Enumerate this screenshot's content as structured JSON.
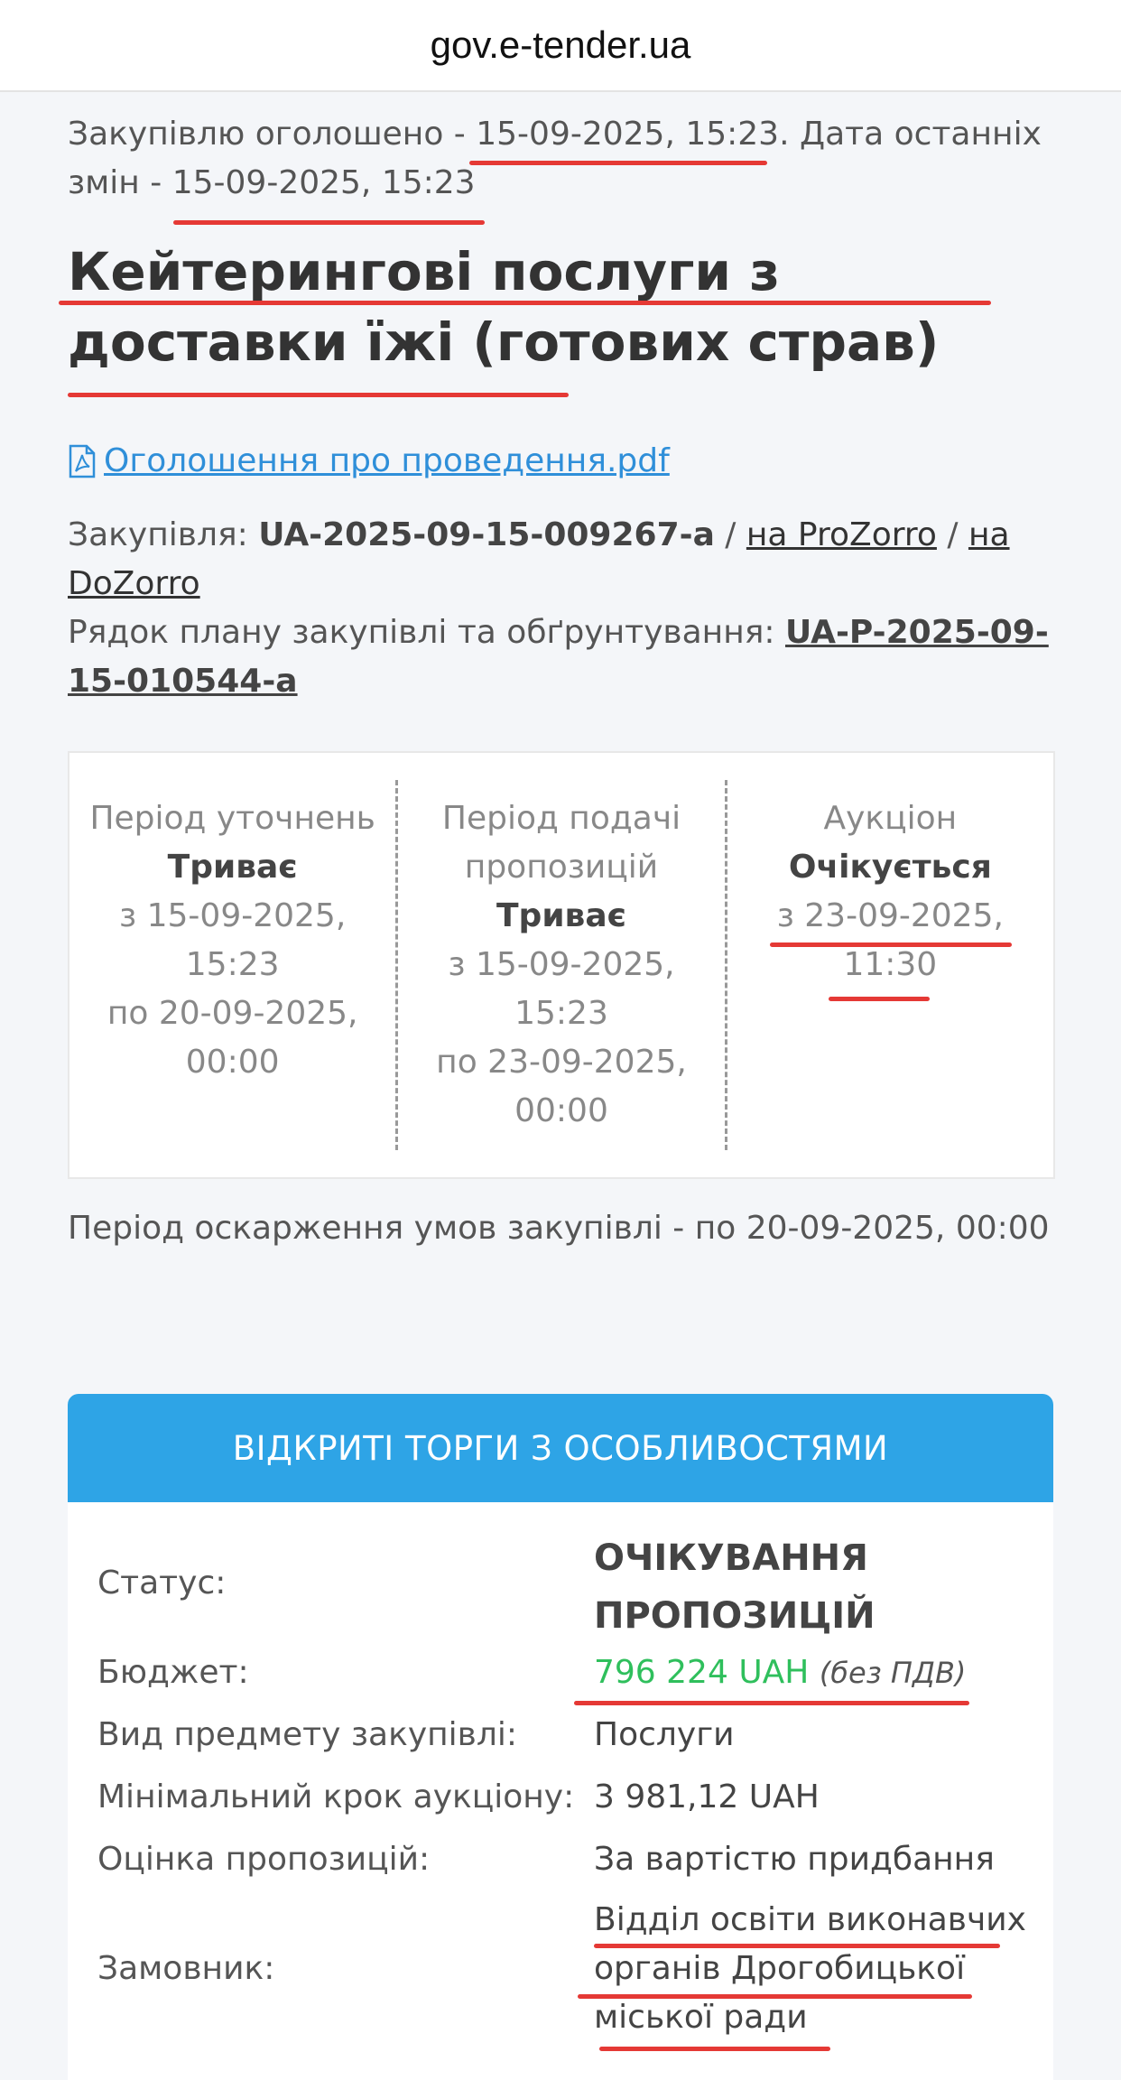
{
  "browser": {
    "url": "gov.e-tender.ua"
  },
  "announcement": {
    "prefix": "Закупівлю оголошено - ",
    "published": "15-09-2025, 15:23",
    "middle": ". Дата останніх змін - ",
    "modified": "15-09-2025, 15:23"
  },
  "title": "Кейтерингові послуги з доставки їжі (готових страв)",
  "document_link": "Оголошення про проведення.pdf",
  "ids": {
    "tender_label": "Закупівля: ",
    "tender_id": "UA-2025-09-15-009267-a",
    "sep1": " / ",
    "prozorro": "на ProZorro",
    "sep2": " / ",
    "dozorro": "на DoZorro",
    "plan_label": "Рядок плану закупівлі та обґрунтування: ",
    "plan_id": "UA-P-2025-09-15-010544-a"
  },
  "periods": [
    {
      "name": "Період уточнень",
      "status": "Триває",
      "from": "з 15-09-2025, 15:23",
      "to": "по 20-09-2025, 00:00"
    },
    {
      "name": "Період подачі пропозицій",
      "status": "Триває",
      "from": "з 15-09-2025, 15:23",
      "to": "по 23-09-2025, 00:00"
    },
    {
      "name": "Аукціон",
      "status": "Очікується",
      "from": "з 23-09-2025, 11:30",
      "to": ""
    }
  ],
  "appeal": "Період оскарження умов закупівлі - по 20-09-2025, 00:00",
  "card": {
    "header": "ВІДКРИТІ ТОРГИ З ОСОБЛИВОСТЯМИ",
    "status_label": "Статус:",
    "status_value": "ОЧІКУВАННЯ ПРОПОЗИЦІЙ",
    "budget_label": "Бюджет:",
    "budget_value": "796 224 UAH",
    "budget_note": "(без ПДВ)",
    "subject_label": "Вид предмету закупівлі:",
    "subject_value": "Послуги",
    "step_label": "Мінімальний крок аукціону:",
    "step_value": "3 981,12 UAH",
    "eval_label": "Оцінка пропозицій:",
    "eval_value": "За вартістю придбання",
    "customer_label": "Замовник:",
    "customer_value": "Відділ освіти виконавчих органів Дрогобицької міської ради"
  },
  "colors": {
    "accent": "#2ea4e6",
    "budget": "#2fbf5c",
    "annotation": "#e53935",
    "link": "#2f8fd9"
  }
}
